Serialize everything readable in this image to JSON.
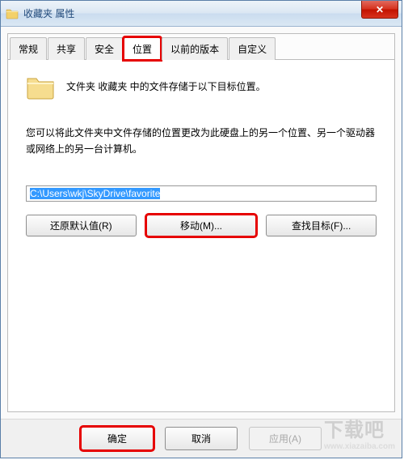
{
  "window": {
    "title": "收藏夹 属性",
    "close_glyph": "✕"
  },
  "tabs": [
    "常规",
    "共享",
    "安全",
    "位置",
    "以前的版本",
    "自定义"
  ],
  "active_tab_index": 3,
  "content": {
    "line1": "文件夹  收藏夹  中的文件存储于以下目标位置。",
    "line2": "您可以将此文件夹中文件存储的位置更改为此硬盘上的另一个位置、另一个驱动器或网络上的另一台计算机。",
    "path_value": "C:\\Users\\wkj\\SkyDrive\\favorite"
  },
  "buttons": {
    "restore": "还原默认值(R)",
    "move": "移动(M)...",
    "find": "查找目标(F)...",
    "ok": "确定",
    "cancel": "取消",
    "apply": "应用(A)"
  },
  "watermark": {
    "main": "下载吧",
    "sub": "www.xiazaiba.com"
  }
}
